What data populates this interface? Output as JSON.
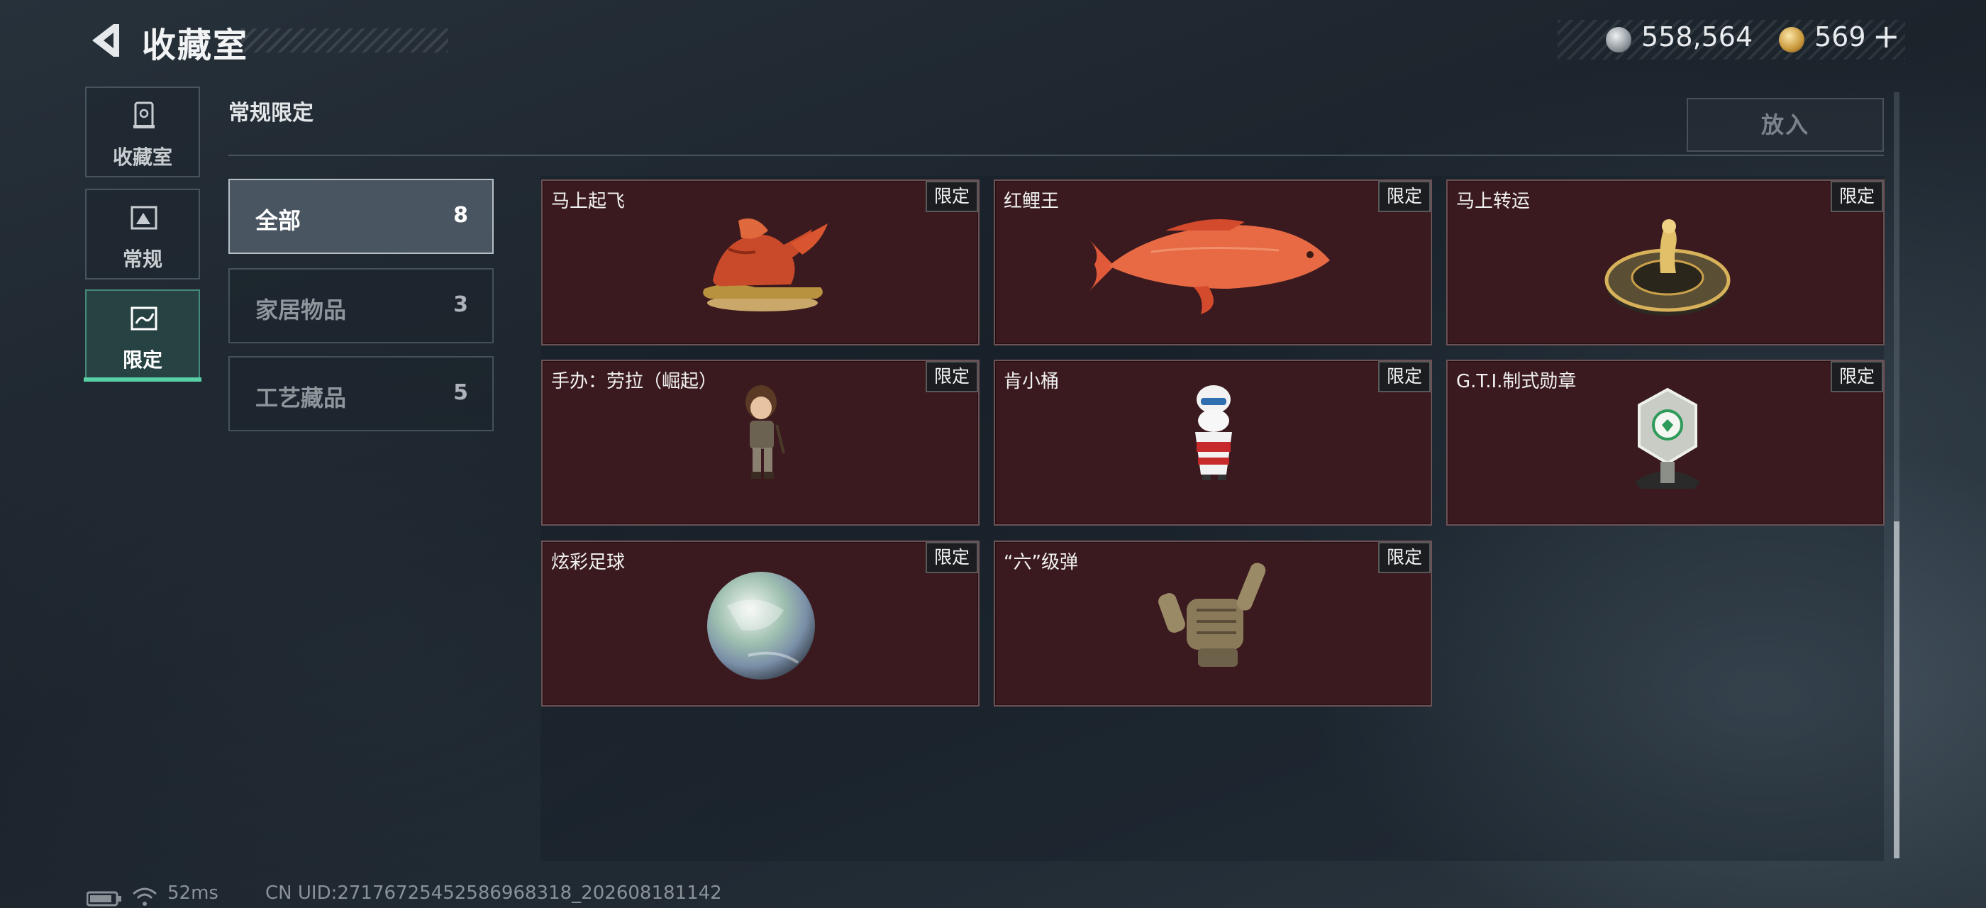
{
  "header": {
    "title": "收藏室",
    "currency": {
      "silver_amount": "558,564",
      "gold_amount": "569",
      "add_symbol": "+"
    }
  },
  "nav": {
    "tabs": [
      {
        "label": "收藏室",
        "icon": "display-case-icon"
      },
      {
        "label": "常规",
        "icon": "picture-frame-icon"
      },
      {
        "label": "限定",
        "icon": "limited-frame-icon",
        "active": true
      }
    ]
  },
  "section": {
    "title": "常规限定",
    "put_button": "放入"
  },
  "filters": [
    {
      "label": "全部",
      "count": "8",
      "active": true
    },
    {
      "label": "家居物品",
      "count": "3"
    },
    {
      "label": "工艺藏品",
      "count": "5"
    }
  ],
  "items": [
    {
      "name": "马上起飞",
      "badge": "限定",
      "icon": "flying-horse-icon"
    },
    {
      "name": "红鲤王",
      "badge": "限定",
      "icon": "red-carp-icon"
    },
    {
      "name": "马上转运",
      "badge": "限定",
      "icon": "fortune-wheel-horse-icon"
    },
    {
      "name": "手办：劳拉（崛起）",
      "badge": "限定",
      "icon": "lara-figure-icon"
    },
    {
      "name": "肯小桶",
      "badge": "限定",
      "icon": "kfc-bucket-figure-icon"
    },
    {
      "name": "G.T.I.制式勋章",
      "badge": "限定",
      "icon": "gti-medal-icon"
    },
    {
      "name": "炫彩足球",
      "badge": "限定",
      "icon": "iridescent-football-icon"
    },
    {
      "name": "“六”级弹",
      "badge": "限定",
      "icon": "shaka-hand-icon"
    }
  ],
  "status": {
    "ping": "52ms",
    "uid": "CN UID:27176725452586968318_202608181142"
  }
}
